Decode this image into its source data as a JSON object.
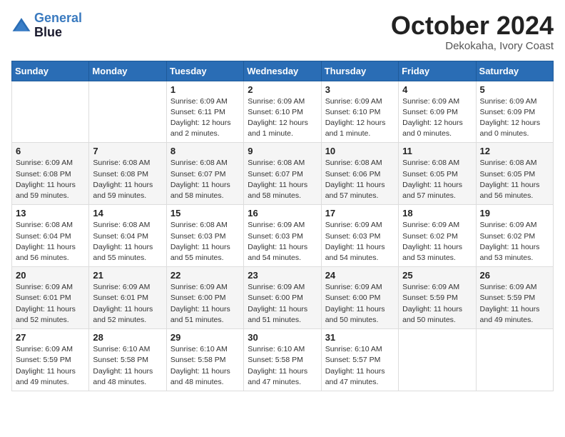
{
  "header": {
    "logo_line1": "General",
    "logo_line2": "Blue",
    "month": "October 2024",
    "location": "Dekokaha, Ivory Coast"
  },
  "weekdays": [
    "Sunday",
    "Monday",
    "Tuesday",
    "Wednesday",
    "Thursday",
    "Friday",
    "Saturday"
  ],
  "weeks": [
    [
      {
        "day": "",
        "info": ""
      },
      {
        "day": "",
        "info": ""
      },
      {
        "day": "1",
        "info": "Sunrise: 6:09 AM\nSunset: 6:11 PM\nDaylight: 12 hours\nand 2 minutes."
      },
      {
        "day": "2",
        "info": "Sunrise: 6:09 AM\nSunset: 6:10 PM\nDaylight: 12 hours\nand 1 minute."
      },
      {
        "day": "3",
        "info": "Sunrise: 6:09 AM\nSunset: 6:10 PM\nDaylight: 12 hours\nand 1 minute."
      },
      {
        "day": "4",
        "info": "Sunrise: 6:09 AM\nSunset: 6:09 PM\nDaylight: 12 hours\nand 0 minutes."
      },
      {
        "day": "5",
        "info": "Sunrise: 6:09 AM\nSunset: 6:09 PM\nDaylight: 12 hours\nand 0 minutes."
      }
    ],
    [
      {
        "day": "6",
        "info": "Sunrise: 6:09 AM\nSunset: 6:08 PM\nDaylight: 11 hours\nand 59 minutes."
      },
      {
        "day": "7",
        "info": "Sunrise: 6:08 AM\nSunset: 6:08 PM\nDaylight: 11 hours\nand 59 minutes."
      },
      {
        "day": "8",
        "info": "Sunrise: 6:08 AM\nSunset: 6:07 PM\nDaylight: 11 hours\nand 58 minutes."
      },
      {
        "day": "9",
        "info": "Sunrise: 6:08 AM\nSunset: 6:07 PM\nDaylight: 11 hours\nand 58 minutes."
      },
      {
        "day": "10",
        "info": "Sunrise: 6:08 AM\nSunset: 6:06 PM\nDaylight: 11 hours\nand 57 minutes."
      },
      {
        "day": "11",
        "info": "Sunrise: 6:08 AM\nSunset: 6:05 PM\nDaylight: 11 hours\nand 57 minutes."
      },
      {
        "day": "12",
        "info": "Sunrise: 6:08 AM\nSunset: 6:05 PM\nDaylight: 11 hours\nand 56 minutes."
      }
    ],
    [
      {
        "day": "13",
        "info": "Sunrise: 6:08 AM\nSunset: 6:04 PM\nDaylight: 11 hours\nand 56 minutes."
      },
      {
        "day": "14",
        "info": "Sunrise: 6:08 AM\nSunset: 6:04 PM\nDaylight: 11 hours\nand 55 minutes."
      },
      {
        "day": "15",
        "info": "Sunrise: 6:08 AM\nSunset: 6:03 PM\nDaylight: 11 hours\nand 55 minutes."
      },
      {
        "day": "16",
        "info": "Sunrise: 6:09 AM\nSunset: 6:03 PM\nDaylight: 11 hours\nand 54 minutes."
      },
      {
        "day": "17",
        "info": "Sunrise: 6:09 AM\nSunset: 6:03 PM\nDaylight: 11 hours\nand 54 minutes."
      },
      {
        "day": "18",
        "info": "Sunrise: 6:09 AM\nSunset: 6:02 PM\nDaylight: 11 hours\nand 53 minutes."
      },
      {
        "day": "19",
        "info": "Sunrise: 6:09 AM\nSunset: 6:02 PM\nDaylight: 11 hours\nand 53 minutes."
      }
    ],
    [
      {
        "day": "20",
        "info": "Sunrise: 6:09 AM\nSunset: 6:01 PM\nDaylight: 11 hours\nand 52 minutes."
      },
      {
        "day": "21",
        "info": "Sunrise: 6:09 AM\nSunset: 6:01 PM\nDaylight: 11 hours\nand 52 minutes."
      },
      {
        "day": "22",
        "info": "Sunrise: 6:09 AM\nSunset: 6:00 PM\nDaylight: 11 hours\nand 51 minutes."
      },
      {
        "day": "23",
        "info": "Sunrise: 6:09 AM\nSunset: 6:00 PM\nDaylight: 11 hours\nand 51 minutes."
      },
      {
        "day": "24",
        "info": "Sunrise: 6:09 AM\nSunset: 6:00 PM\nDaylight: 11 hours\nand 50 minutes."
      },
      {
        "day": "25",
        "info": "Sunrise: 6:09 AM\nSunset: 5:59 PM\nDaylight: 11 hours\nand 50 minutes."
      },
      {
        "day": "26",
        "info": "Sunrise: 6:09 AM\nSunset: 5:59 PM\nDaylight: 11 hours\nand 49 minutes."
      }
    ],
    [
      {
        "day": "27",
        "info": "Sunrise: 6:09 AM\nSunset: 5:59 PM\nDaylight: 11 hours\nand 49 minutes."
      },
      {
        "day": "28",
        "info": "Sunrise: 6:10 AM\nSunset: 5:58 PM\nDaylight: 11 hours\nand 48 minutes."
      },
      {
        "day": "29",
        "info": "Sunrise: 6:10 AM\nSunset: 5:58 PM\nDaylight: 11 hours\nand 48 minutes."
      },
      {
        "day": "30",
        "info": "Sunrise: 6:10 AM\nSunset: 5:58 PM\nDaylight: 11 hours\nand 47 minutes."
      },
      {
        "day": "31",
        "info": "Sunrise: 6:10 AM\nSunset: 5:57 PM\nDaylight: 11 hours\nand 47 minutes."
      },
      {
        "day": "",
        "info": ""
      },
      {
        "day": "",
        "info": ""
      }
    ]
  ]
}
